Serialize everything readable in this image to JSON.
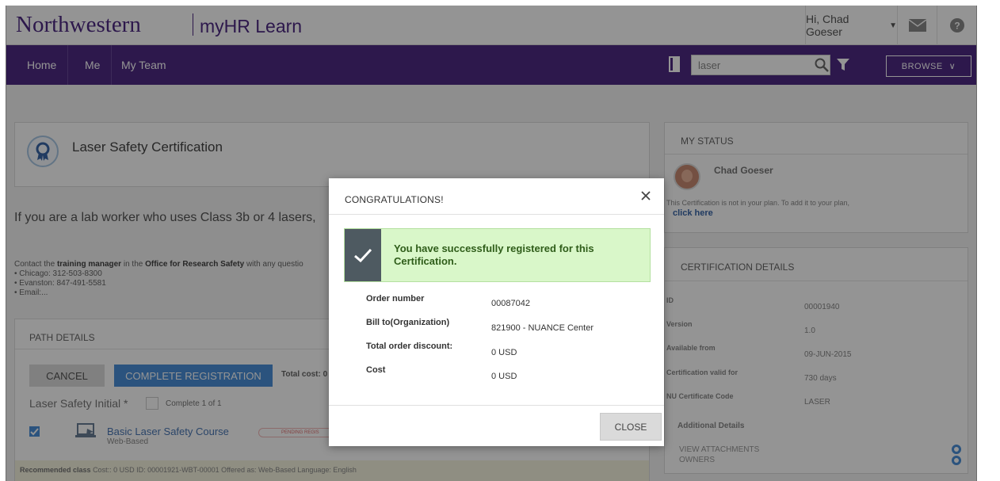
{
  "brand": {
    "name": "Northwestern",
    "product": "myHR Learn"
  },
  "header": {
    "greeting": "Hi, Chad Goeser"
  },
  "nav": {
    "items": [
      "Home",
      "Me",
      "My Team"
    ]
  },
  "search": {
    "value": "laser"
  },
  "browse": {
    "label": "BROWSE"
  },
  "course": {
    "title": "Laser Safety Certification",
    "description": "If you are a lab worker who uses Class 3b or 4 lasers,",
    "contact_prefix": "Contact the",
    "contact_manager": "training manager",
    "contact_mid": "in the",
    "contact_office": "Office for Research Safety",
    "contact_suffix": "with any questio",
    "phones": [
      "• Chicago: 312-503-8300",
      "• Evanston: 847-491-5581",
      "• Email:..."
    ]
  },
  "path": {
    "header": "PATH DETAILS",
    "cancel_label": "CANCEL",
    "complete_label": "COMPLETE REGISTRATION",
    "total_cost": "Total cost: 0",
    "initial_label": "Laser Safety Initial *",
    "complete_of": "Complete 1 of 1",
    "course_name": "Basic Laser Safety Course",
    "course_type": "Web-Based",
    "pending": "PENDING REGIS",
    "recommended": "Recommended class",
    "rec_details": "Cost:: 0 USD  ID: 00001921-WBT-00001  Offered as: Web-Based  Language: English"
  },
  "status": {
    "header": "MY STATUS",
    "name": "Chad Goeser",
    "message": "This Certification is not in your plan. To add it to your plan,",
    "link": "click here"
  },
  "cert_details": {
    "header": "CERTIFICATION DETAILS",
    "rows": [
      {
        "label": "ID",
        "value": "00001940"
      },
      {
        "label": "Version",
        "value": "1.0"
      },
      {
        "label": "Available from",
        "value": "09-JUN-2015"
      },
      {
        "label": "Certification valid for",
        "value": "730 days"
      },
      {
        "label": "NU Certificate Code",
        "value": "LASER"
      }
    ],
    "additional": "Additional Details",
    "attachments": "VIEW ATTACHMENTS",
    "owners": "OWNERS"
  },
  "modal": {
    "title": "CONGRATULATIONS!",
    "success_message": "You have successfully registered for this Certification.",
    "order_rows": [
      {
        "label": "Order number",
        "value": "00087042"
      },
      {
        "label": "Bill to(Organization)",
        "value": "821900 - NUANCE Center"
      },
      {
        "label": "Total order discount:",
        "value": "0 USD"
      },
      {
        "label": "Cost",
        "value": "0 USD"
      }
    ],
    "close_label": "CLOSE"
  },
  "colors": {
    "brand_purple": "#4e2a84",
    "link_blue": "#4a90d9",
    "success_green": "#d9f7c9"
  }
}
